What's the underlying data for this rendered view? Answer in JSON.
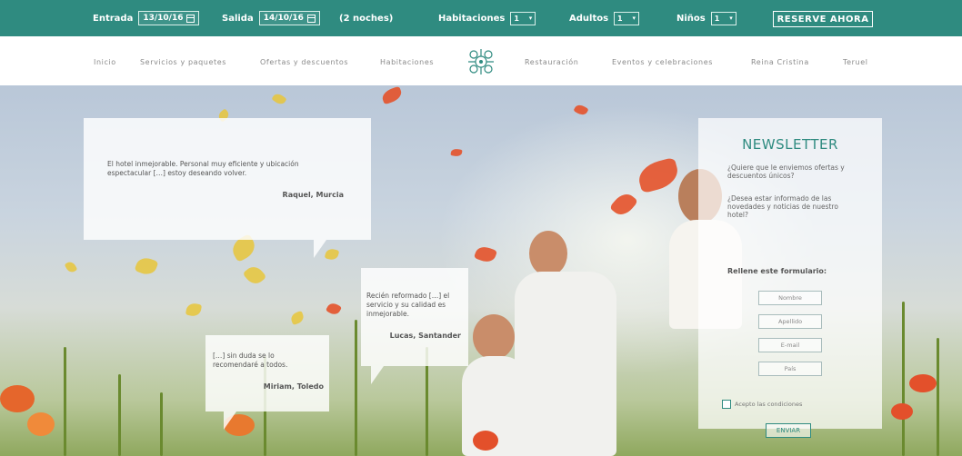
{
  "booking": {
    "checkin_label": "Entrada",
    "checkin_value": "13/10/16",
    "checkout_label": "Salida",
    "checkout_value": "14/10/16",
    "nights": "(2 noches)",
    "rooms_label": "Habitaciones",
    "rooms_value": "1",
    "adults_label": "Adultos",
    "adults_value": "1",
    "children_label": "Niños",
    "children_value": "1",
    "reserve_label": "RESERVE AHORA",
    "brand_color": "#2f8b80"
  },
  "nav": {
    "items": [
      "Inicio",
      "Servicios y paquetes",
      "Ofertas y descuentos",
      "Habitaciones",
      "Restauración",
      "Eventos y celebraciones",
      "Reina Cristina",
      "Teruel"
    ],
    "logo_icon": "hotel-crest-icon"
  },
  "testimonials": [
    {
      "text": "El hotel inmejorable. Personal muy eficiente y ubicación espectacular […] estoy deseando volver.",
      "author": "Raquel,  Murcia"
    },
    {
      "text": "Recién reformado […] el servicio y su calidad es inmejorable.",
      "author": "Lucas,  Santander"
    },
    {
      "text": "[…] sin duda se lo recomendaré a todos.",
      "author": "Miriam,  Toledo"
    }
  ],
  "newsletter": {
    "title": "NEWSLETTER",
    "question1": "¿Quiere que le enviemos ofertas y descuentos únicos?",
    "question2": "¿Desea estar informado de las novedades y noticias de nuestro hotel?",
    "form_title": "Rellene este formulario:",
    "fields": [
      "Nombre",
      "Apellido",
      "E-mail",
      "País"
    ],
    "accept_label": "Acepto las condiciones",
    "send_label": "ENVIAR"
  }
}
